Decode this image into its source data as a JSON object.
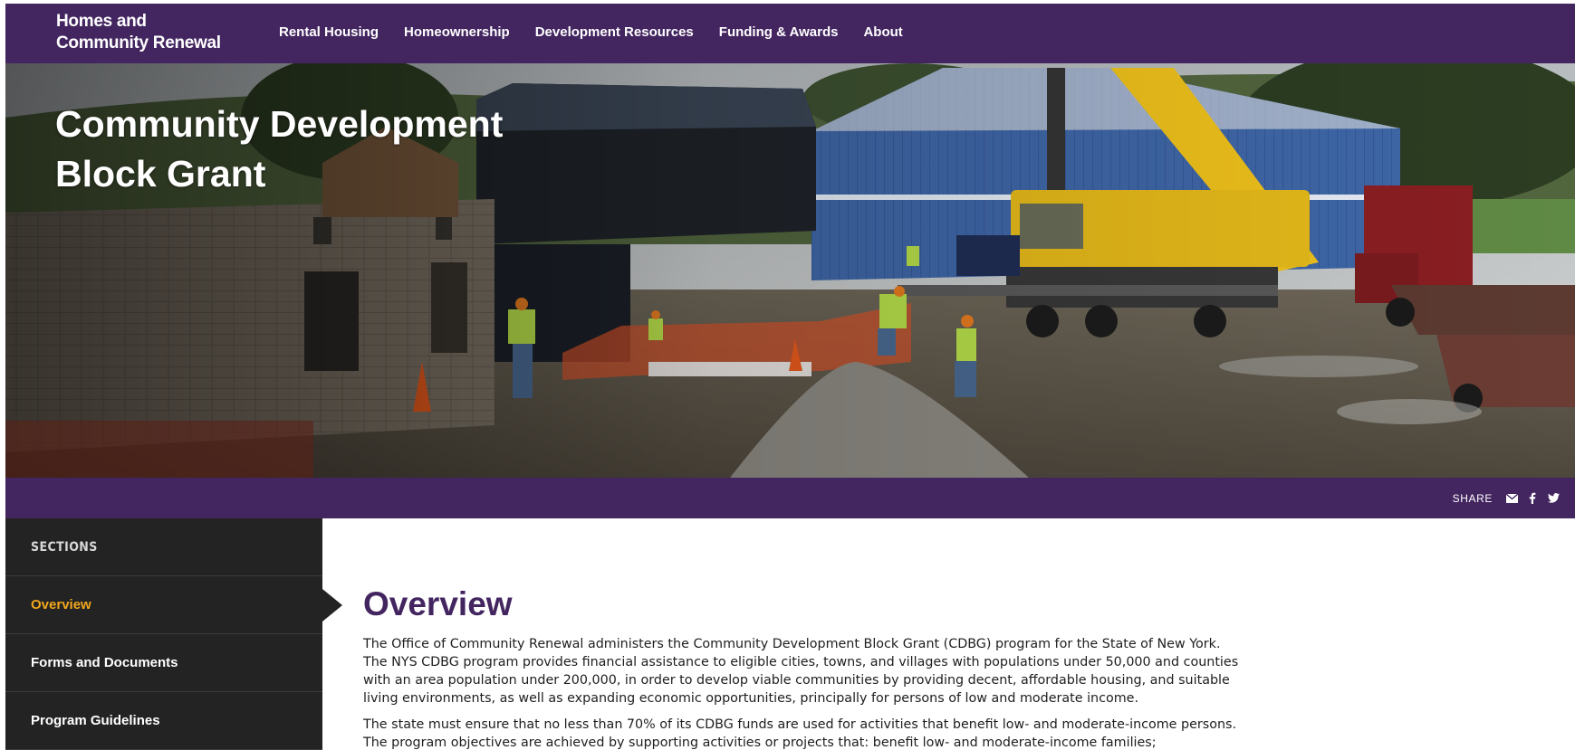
{
  "brand": {
    "line1": "Homes and",
    "line2": "Community Renewal"
  },
  "nav": {
    "items": [
      {
        "label": "Rental Housing"
      },
      {
        "label": "Homeownership"
      },
      {
        "label": "Development Resources"
      },
      {
        "label": "Funding & Awards"
      },
      {
        "label": "About"
      }
    ]
  },
  "hero": {
    "title_line1": "Community Development",
    "title_line2": "Block Grant"
  },
  "share": {
    "label": "SHARE",
    "icons": [
      "email-icon",
      "facebook-icon",
      "twitter-icon"
    ]
  },
  "sidebar": {
    "heading": "SECTIONS",
    "items": [
      {
        "label": "Overview",
        "active": true
      },
      {
        "label": "Forms and Documents",
        "active": false
      },
      {
        "label": "Program Guidelines",
        "active": false
      }
    ]
  },
  "main": {
    "heading": "Overview",
    "paragraphs": [
      "The Office of Community Renewal administers the Community Development Block Grant (CDBG) program for the State of New York. The NYS CDBG program provides financial assistance to eligible cities, towns, and villages with populations under 50,000 and counties with an area population under 200,000, in order to develop viable communities by providing decent, affordable housing, and suitable living environments, as well as expanding economic opportunities, principally for persons of low and moderate income.",
      "The state must ensure that no less than 70% of its CDBG funds are used for activities that benefit low- and moderate-income persons. The program objectives are achieved by supporting activities or projects that: benefit low- and moderate-income families;"
    ]
  },
  "colors": {
    "brand_purple": "#432560",
    "active_orange": "#f2a81d",
    "sidebar_bg": "#232323"
  }
}
